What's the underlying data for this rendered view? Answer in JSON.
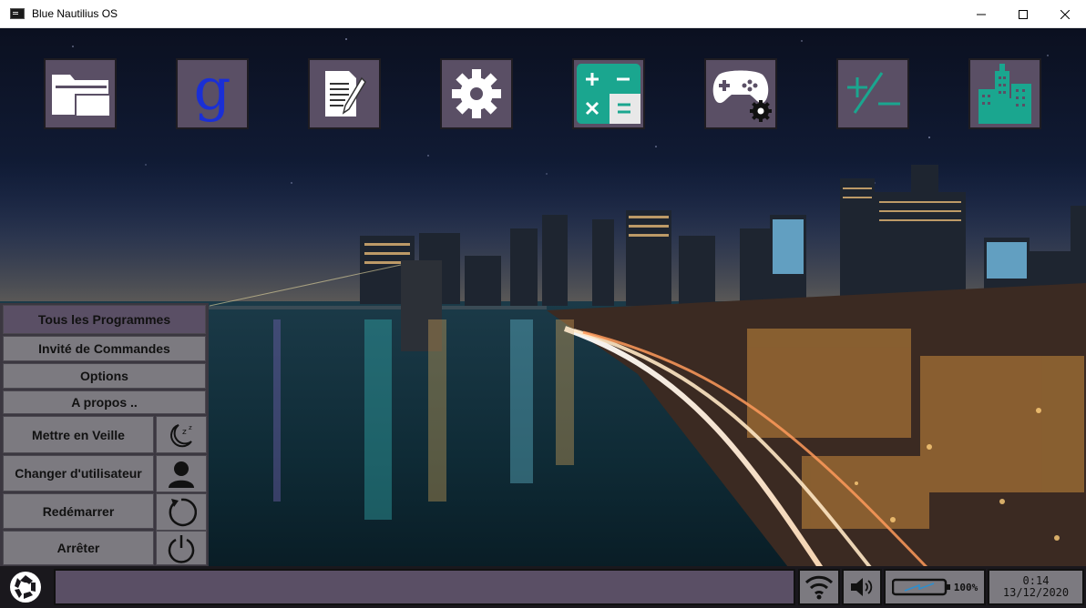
{
  "window": {
    "title": "Blue Nautilius OS",
    "controls": [
      "minimize-icon",
      "maximize-icon",
      "close-icon"
    ]
  },
  "desktop": {
    "icons": [
      {
        "name": "file-explorer",
        "icon": "folder-icon"
      },
      {
        "name": "google",
        "icon": "google-g-icon",
        "label": "g"
      },
      {
        "name": "text-editor",
        "icon": "document-edit-icon"
      },
      {
        "name": "settings",
        "icon": "gear-icon"
      },
      {
        "name": "calculator",
        "icon": "calculator-icon"
      },
      {
        "name": "game-settings",
        "icon": "gamepad-gear-icon"
      },
      {
        "name": "plus-minus",
        "icon": "plus-minus-icon"
      },
      {
        "name": "city",
        "icon": "building-icon"
      }
    ],
    "accent_colors": {
      "tile": "#5a4f65",
      "menu": "#7c7a80",
      "teal": "#1aa68f",
      "google_blue": "#1a2fd6"
    }
  },
  "start_menu": {
    "items": [
      {
        "label": "Tous les Programmes"
      },
      {
        "label": "Invité de Commandes"
      },
      {
        "label": "Options"
      },
      {
        "label": "A propos .."
      }
    ],
    "power": [
      {
        "label": "Mettre en Veille",
        "icon": "sleep-moon-icon"
      },
      {
        "label": "Changer d'utilisateur",
        "icon": "user-icon"
      },
      {
        "label": "Redémarrer",
        "icon": "restart-icon"
      },
      {
        "label": "Arrêter",
        "icon": "power-icon"
      }
    ]
  },
  "taskbar": {
    "start_icon": "aperture-icon",
    "wifi_icon": "wifi-icon",
    "volume_icon": "speaker-icon",
    "battery_icon": "battery-icon",
    "battery_percent": "100%",
    "time": "0:14",
    "date": "13/12/2020"
  }
}
